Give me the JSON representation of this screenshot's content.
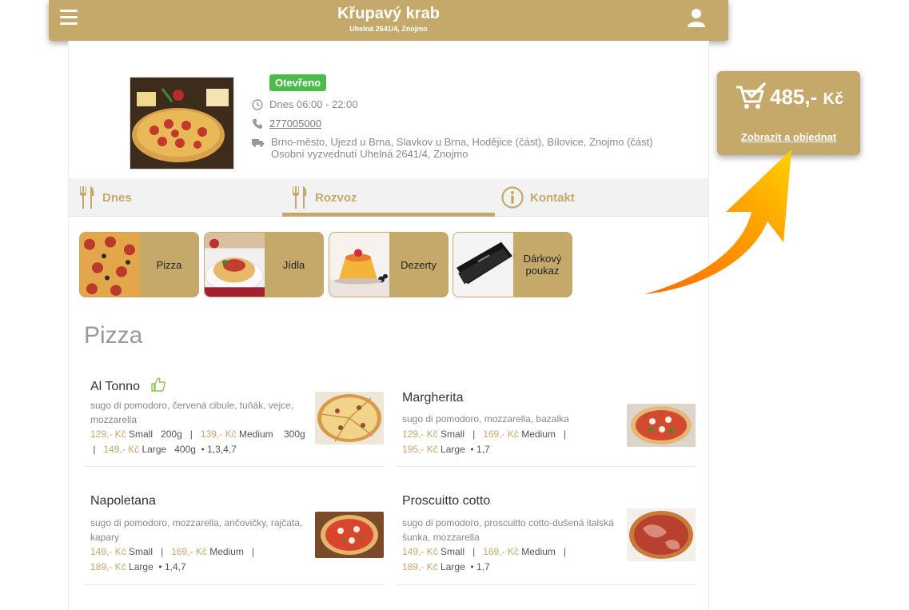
{
  "header": {
    "title": "Křupavý krab",
    "subtitle": "Uhelná 2641/4, Znojmo"
  },
  "restaurant": {
    "status": "Otevřeno",
    "hours": "Dnes 06:00 - 22:00",
    "phone": "277005000",
    "delivery_areas": "Brno-město, Ujezd u Brna, Slavkov u Brna, Hodějice (část), Bílovice, Znojmo (část)",
    "pickup": "Osobní vyzvednutí Uhelná 2641/4, Znojmo"
  },
  "tabs": [
    {
      "label": "Dnes"
    },
    {
      "label": "Rozvoz"
    },
    {
      "label": "Kontakt"
    }
  ],
  "categories": [
    {
      "label": "Pizza"
    },
    {
      "label": "Jídla"
    },
    {
      "label": "Dezerty"
    },
    {
      "label": "Dárkový poukaz"
    }
  ],
  "section_title": "Pizza",
  "dishes": [
    {
      "name": "Al Tonno",
      "desc": "sugo di pomodoro, červená cibule, tuňák, vejce, mozzarella",
      "p1": "129,- Kč",
      "s1": "Small",
      "w1": "200g",
      "p2": "139,- Kč",
      "s2": "Medium",
      "w2": "300g",
      "p3": "149,- Kč",
      "s3": "Large",
      "w3": "400g",
      "allergens": "1,3,4,7"
    },
    {
      "name": "Margherita",
      "desc": "sugo di pomodoro, mozzarella, bazalka",
      "p1": "129,- Kč",
      "s1": "Small",
      "p2": "169,- Kč",
      "s2": "Medium",
      "p3": "195,- Kč",
      "s3": "Large",
      "allergens": "1,7"
    },
    {
      "name": "Napoletana",
      "desc": "sugo di pomodoro, mozzarella, ančovičky, rajčata, kapary",
      "p1": "149,- Kč",
      "s1": "Small",
      "p2": "169,- Kč",
      "s2": "Medium",
      "p3": "189,- Kč",
      "s3": "Large",
      "allergens": "1,4,7"
    },
    {
      "name": "Proscuitto cotto",
      "desc": "sugo di pomodoro, proscuitto cotto-dušená italská šunka, mozzarella",
      "p1": "149,- Kč",
      "s1": "Small",
      "p2": "169,- Kč",
      "s2": "Medium",
      "p3": "189,- Kč",
      "s3": "Large",
      "allergens": "1,7"
    }
  ],
  "cart": {
    "amount": "485,-",
    "currency": "Kč",
    "link": "Zobrazit a objednat"
  },
  "colors": {
    "accent": "#c4a96b",
    "open": "#4cbb4c",
    "arrow_start": "#ff6a00",
    "arrow_end": "#ffd000"
  },
  "icons": [
    "menu-icon",
    "user-icon",
    "clock-icon",
    "phone-icon",
    "delivery-truck-icon",
    "cutlery-icon",
    "info-icon",
    "thumbs-up-icon",
    "cart-check-icon"
  ]
}
